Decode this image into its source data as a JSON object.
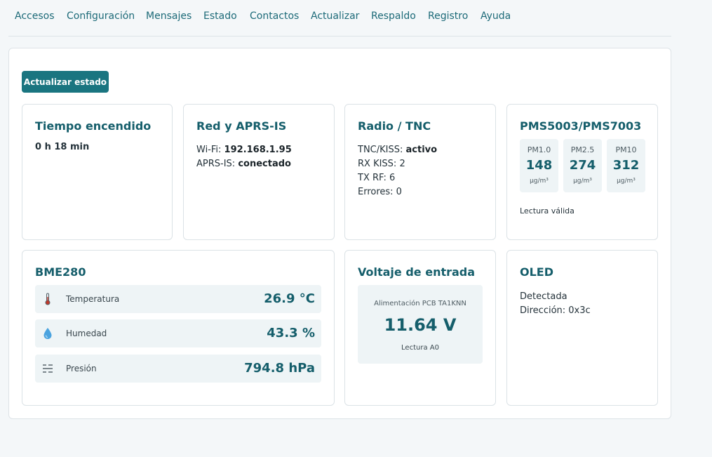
{
  "nav": {
    "items": [
      "Accesos",
      "Configuración",
      "Mensajes",
      "Estado",
      "Contactos",
      "Actualizar",
      "Respaldo",
      "Registro",
      "Ayuda"
    ]
  },
  "actions": {
    "refresh_label": "Actualizar estado"
  },
  "uptime": {
    "title": "Tiempo encendido",
    "value": "0 h 18 min"
  },
  "network": {
    "title": "Red y APRS-IS",
    "wifi_label": "Wi-Fi: ",
    "wifi_value": "192.168.1.95",
    "aprs_label": "APRS-IS: ",
    "aprs_value": "conectado"
  },
  "radio": {
    "title": "Radio / TNC",
    "tnc_label": "TNC/KISS: ",
    "tnc_value": "activo",
    "rx_kiss": "RX KISS: 2",
    "tx_rf": "TX RF: 6",
    "errors": "Errores: 0"
  },
  "pms": {
    "title": "PMS5003/PMS7003",
    "boxes": [
      {
        "label": "PM1.0",
        "value": "148",
        "unit": "µg/m³"
      },
      {
        "label": "PM2.5",
        "value": "274",
        "unit": "µg/m³"
      },
      {
        "label": "PM10",
        "value": "312",
        "unit": "µg/m³"
      }
    ],
    "status": "Lectura válida"
  },
  "bme": {
    "title": "BME280",
    "rows": [
      {
        "icon": "thermometer-icon",
        "label": "Temperatura",
        "value": "26.9 °C"
      },
      {
        "icon": "droplet-icon",
        "label": "Humedad",
        "value": "43.3 %"
      },
      {
        "icon": "pressure-icon",
        "label": "Presión",
        "value": "794.8 hPa"
      }
    ]
  },
  "voltage": {
    "title": "Voltaje de entrada",
    "caption": "Alimentación PCB TA1KNN",
    "value": "11.64 V",
    "source": "Lectura A0"
  },
  "oled": {
    "title": "OLED",
    "status": "Detectada",
    "address": "Dirección: 0x3c"
  },
  "colors": {
    "accent": "#1a7580",
    "heading": "#155e6b",
    "tile": "#eef4f6"
  }
}
